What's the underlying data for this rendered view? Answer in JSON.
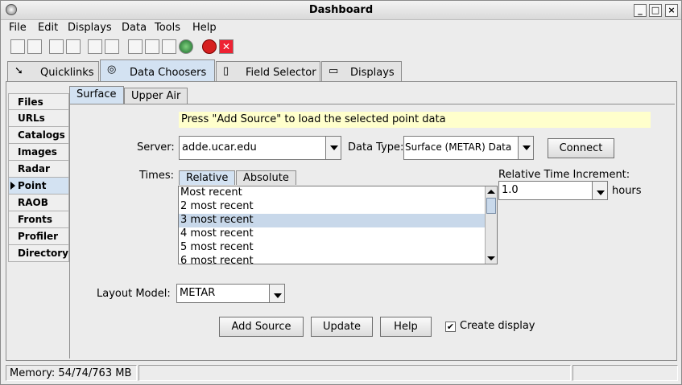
{
  "window": {
    "title": "Dashboard"
  },
  "menubar": [
    {
      "label": "File"
    },
    {
      "label": "Edit"
    },
    {
      "label": "Displays"
    },
    {
      "label": "Data"
    },
    {
      "label": "Tools"
    },
    {
      "label": "Help"
    }
  ],
  "toolbar_icons": [
    "home-icon",
    "new-window-icon",
    "link-icon",
    "copy-icon",
    "eraser-icon",
    "cut-icon",
    "edit-icon",
    "axis-icon",
    "probe-icon",
    "globe-icon",
    "stop-icon",
    "cancel-icon"
  ],
  "main_tabs": [
    {
      "label": "Quicklinks",
      "icon": "quicklinks-icon"
    },
    {
      "label": "Data Choosers",
      "icon": "binoculars-icon",
      "selected": true
    },
    {
      "label": "Field Selector",
      "icon": "clipboard-icon"
    },
    {
      "label": "Displays",
      "icon": "monitor-icon"
    }
  ],
  "sidebar": {
    "items": [
      "Files",
      "URLs",
      "Catalogs",
      "Images",
      "Radar",
      "Point",
      "RAOB",
      "Fronts",
      "Profiler",
      "Directory"
    ],
    "selected": "Point"
  },
  "sub_tabs": [
    {
      "label": "Surface",
      "selected": true
    },
    {
      "label": "Upper Air"
    }
  ],
  "message": "Press \"Add Source\" to load the selected point data",
  "server": {
    "label": "Server:",
    "value": "adde.ucar.edu"
  },
  "data_type": {
    "label": "Data Type:",
    "value": "Surface (METAR) Data"
  },
  "connect_label": "Connect",
  "times": {
    "label": "Times:",
    "tabs": [
      {
        "label": "Relative",
        "selected": true
      },
      {
        "label": "Absolute"
      }
    ],
    "items": [
      "Most recent",
      "2 most recent",
      "3 most recent",
      "4 most recent",
      "5 most recent",
      "6 most recent"
    ],
    "selected": "3 most recent"
  },
  "increment": {
    "label": "Relative Time Increment:",
    "value": "1.0",
    "unit": "hours"
  },
  "layout_model": {
    "label": "Layout Model:",
    "value": "METAR"
  },
  "buttons": {
    "add_source": "Add Source",
    "update": "Update",
    "help": "Help"
  },
  "create_display": {
    "label": "Create display",
    "checked": true
  },
  "status": {
    "memory": "Memory: 54/74/763 MB"
  },
  "colors": {
    "selected_tab": "#d3e2f2",
    "message_bg": "#ffffcc",
    "list_selection": "#c8d8ea"
  }
}
